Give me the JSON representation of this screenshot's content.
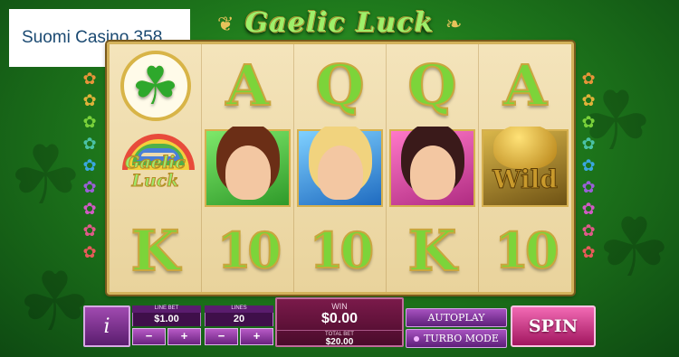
{
  "brand": {
    "name": "Suomi Casino 358"
  },
  "game": {
    "title": "Gaelic Luck"
  },
  "reels": {
    "rows": [
      [
        {
          "kind": "clover",
          "icon": "clover-icon"
        },
        {
          "kind": "letter",
          "label": "A"
        },
        {
          "kind": "letter",
          "label": "Q"
        },
        {
          "kind": "letter",
          "label": "Q"
        },
        {
          "kind": "letter",
          "label": "A"
        }
      ],
      [
        {
          "kind": "logo",
          "label": "Gaelic Luck"
        },
        {
          "kind": "portrait",
          "style": "green"
        },
        {
          "kind": "portrait",
          "style": "blue"
        },
        {
          "kind": "portrait",
          "style": "pink"
        },
        {
          "kind": "wild",
          "label": "Wild"
        }
      ],
      [
        {
          "kind": "letter",
          "label": "K"
        },
        {
          "kind": "ten",
          "label": "10"
        },
        {
          "kind": "ten",
          "label": "10"
        },
        {
          "kind": "letter",
          "label": "K"
        },
        {
          "kind": "ten",
          "label": "10"
        }
      ]
    ]
  },
  "paylines": {
    "colors": [
      "#e8943a",
      "#e0b23a",
      "#7ad13a",
      "#4ac2a6",
      "#3aa7e0",
      "#9b5fd8",
      "#d05ac4",
      "#e05a8a",
      "#e85a5a"
    ]
  },
  "controls": {
    "info_label": "i",
    "line_bet": {
      "label": "LINE BET",
      "value": "$1.00",
      "minus": "−",
      "plus": "+"
    },
    "lines": {
      "label": "LINES",
      "value": "20",
      "minus": "−",
      "plus": "+"
    },
    "win": {
      "label": "WIN",
      "value": "$0.00"
    },
    "total_bet": {
      "label": "TOTAL BET",
      "value": "$20.00"
    },
    "autoplay_label": "AUTOPLAY",
    "turbo_label": "TURBO MODE",
    "spin_label": "SPIN"
  },
  "colors": {
    "felt": "#2f8f26",
    "gold": "#d3b25c",
    "panel": "#5a1d6e",
    "spin": "#d8388c"
  }
}
